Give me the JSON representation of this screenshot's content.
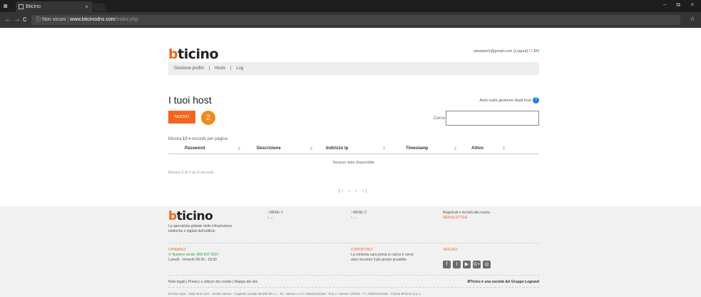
{
  "browser": {
    "tab_title": "Bticino",
    "tab_close": "×",
    "url_warning": "Non sicuro",
    "url_domain": "www.bticinodns.com",
    "url_path": "/index.php",
    "window_controls": "– ⧉ ×",
    "star": "☆",
    "back": "←",
    "forward": "→",
    "reload": "C",
    "info": "ⓘ"
  },
  "header": {
    "logo_b": "b",
    "logo_rest": "ticino",
    "user_email": "utestami1@gmail.com",
    "logout": "(Logout)",
    "lang_it": "IT",
    "lang_en": "EN"
  },
  "subnav": {
    "items": [
      "Gestione profilo",
      "|",
      "Hosts",
      "|",
      "Log"
    ]
  },
  "main": {
    "title": "I tuoi host",
    "help_text": "Aiuto sulla gestione degli host",
    "help_icon": "?",
    "new_button": "NUOVO",
    "step_number": "2",
    "search_label": "Cerca",
    "length_prefix": "Mostra",
    "length_value": "10",
    "length_suffix": "▾ records per pagina",
    "columns": [
      "Password",
      "Descrizione",
      "Indirizzo Ip",
      "Timestamp",
      "Attivo"
    ],
    "sort_icon": "⇕",
    "empty_text": "Nessun dato disponibile",
    "info_text": "Mostra 0 di 0 su 0 records",
    "pager": "|‹ ‹ › ›|"
  },
  "footer": {
    "logo_b": "b",
    "logo_rest": "ticino",
    "tagline": "La specialista globale delle infrastrutture elettriche e digitali dell'edificio",
    "menu1_title": "› MENU 1",
    "menu1_item": "› ....",
    "menu2_title": "› MENU 2",
    "menu2_item": "› ....",
    "newsletter_text": "Registrati e iscriviti alla nostra",
    "newsletter_link": "NEWSLETTER",
    "call_title": "CHIAMACI",
    "call_number": "Numero verde: 800 837 0357",
    "call_hours": "Lunedì - Venerdì 08:30 - 18:30",
    "contact_title": "CONTATTACI",
    "contact_text1": "La richiesta sarà presa in carico e verrà",
    "contact_text2": "dato riscontro il più presto possibile",
    "follow_title": "SEGUICI",
    "social_icons": [
      "f",
      "t",
      "▶",
      "G+",
      "◎"
    ],
    "legal": "Note legali  | Privacy e utilizzo dei cookie  | Mappa del sito",
    "group": "BTicino è una società del Gruppo Legrand",
    "corporate": "BTicino Spa - Viale Borri 231 - 21100 Varese - Capitale sociale 88.800.00 i.v. - R.I. Varese e C.F. 00931240150 - R.E.A. Varese 170034 - P.I. 00931240150 - ©2016 BTicino S.p.A."
  }
}
